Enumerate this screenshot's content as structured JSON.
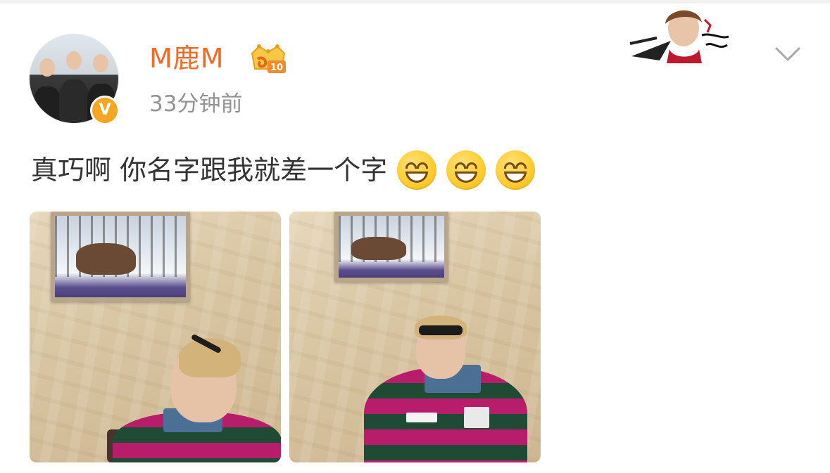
{
  "post": {
    "username": "M鹿M",
    "vip_level": "10",
    "verify_mark": "V",
    "time": "33分钟前",
    "text": "真巧啊 你名字跟我就差一个字",
    "emojis": [
      "grinning-face-emoji",
      "grinning-face-emoji",
      "grinning-face-emoji"
    ],
    "photo_count": 2
  },
  "colors": {
    "username": "#f26b27",
    "time": "#939393",
    "text": "#333333",
    "badge": "#f6a623"
  },
  "icons": {
    "verify": "verified-v-badge",
    "vip": "crown-vip-badge",
    "menu": "chevron-down-icon"
  }
}
